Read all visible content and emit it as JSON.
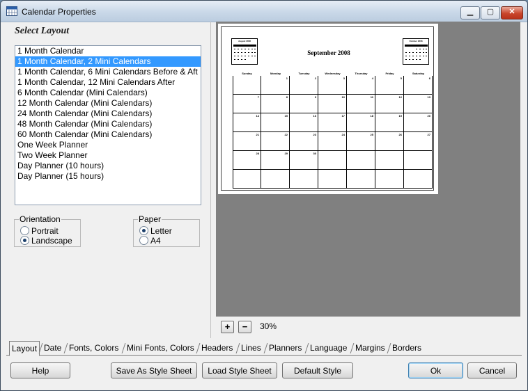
{
  "window": {
    "title": "Calendar Properties"
  },
  "left": {
    "heading": "Select Layout",
    "layouts": [
      "1 Month Calendar",
      "1 Month Calendar, 2 Mini Calendars",
      "1 Month Calendar, 6 Mini Calendars Before & Aft",
      "1 Month Calendar, 12 Mini Calendars After",
      "6 Month Calendar (Mini Calendars)",
      "12 Month Calendar (Mini Calendars)",
      "24 Month Calendar (Mini Calendars)",
      "48 Month Calendar (Mini Calendars)",
      "60 Month Calendar (Mini Calendars)",
      "One Week Planner",
      "Two Week Planner",
      "Day Planner (10 hours)",
      "Day Planner (15 hours)"
    ],
    "selected_index": 1,
    "orientation": {
      "label": "Orientation",
      "options": [
        "Portrait",
        "Landscape"
      ],
      "selected": "Landscape"
    },
    "paper": {
      "label": "Paper",
      "options": [
        "Letter",
        "A4"
      ],
      "selected": "Letter"
    }
  },
  "preview": {
    "month_title": "September 2008",
    "mini_left": "August 2008",
    "mini_right": "October 2008",
    "weekdays": [
      "Sunday",
      "Monday",
      "Tuesday",
      "Wednesday",
      "Thursday",
      "Friday",
      "Saturday"
    ],
    "weeks": [
      [
        "",
        "1",
        "2",
        "3",
        "4",
        "5",
        "6"
      ],
      [
        "7",
        "8",
        "9",
        "10",
        "11",
        "12",
        "13"
      ],
      [
        "14",
        "15",
        "16",
        "17",
        "18",
        "19",
        "20"
      ],
      [
        "21",
        "22",
        "23",
        "24",
        "25",
        "26",
        "27"
      ],
      [
        "28",
        "29",
        "30",
        "",
        "",
        "",
        ""
      ],
      [
        "",
        "",
        "",
        "",
        "",
        "",
        ""
      ]
    ],
    "zoom": "30%"
  },
  "tabs": [
    "Layout",
    "Date",
    "Fonts, Colors",
    "Mini Fonts, Colors",
    "Headers",
    "Lines",
    "Planners",
    "Language",
    "Margins",
    "Borders"
  ],
  "active_tab": "Layout",
  "buttons": {
    "help": "Help",
    "save_style": "Save As Style Sheet",
    "load_style": "Load Style Sheet",
    "default_style": "Default Style",
    "ok": "Ok",
    "cancel": "Cancel"
  },
  "colors": {
    "selection": "#3399ff",
    "preview_bg": "#808080"
  }
}
